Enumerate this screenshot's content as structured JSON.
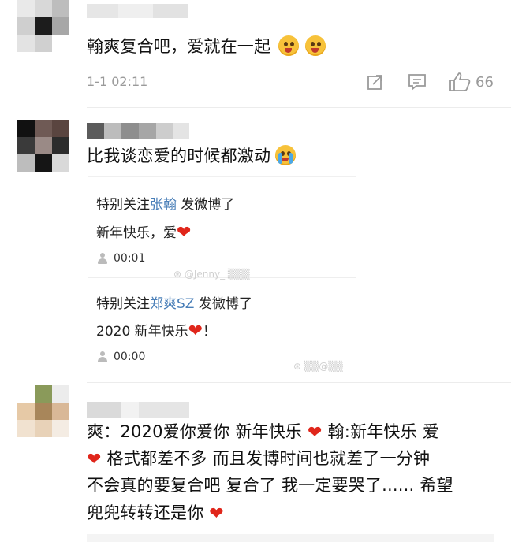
{
  "comments": [
    {
      "text": "翰爽复合吧，爱就在一起",
      "timestamp": "1-1 02:11",
      "like_count": "66"
    },
    {
      "text": "比我谈恋爱的时候都激动",
      "quotes": [
        {
          "prefix": "特别关注",
          "user": "张翰",
          "suffix": " 发微博了",
          "body": "新年快乐，爱",
          "time": "00:01"
        },
        {
          "prefix": "特别关注",
          "user": "郑爽SZ",
          "suffix": " 发微博了",
          "body": "2020 新年快乐",
          "body_tail": "！",
          "time": "00:00"
        }
      ]
    },
    {
      "lines": [
        "爽：2020爱你爱你 新年快乐",
        "翰:新年快乐 爱",
        "格式都差不多 而且发博时间也就差了一分钟",
        "不会真的要复合吧 复合了 我一定要哭了...... 希望",
        "兜兜转转还是你"
      ]
    }
  ],
  "icons": [
    "share-icon",
    "comment-icon",
    "thumbs-up-icon",
    "user-icon",
    "weibo-icon"
  ],
  "colors": {
    "link": "#4a7fb8",
    "heart": "#e0261b",
    "meta": "#9a9a9a"
  }
}
